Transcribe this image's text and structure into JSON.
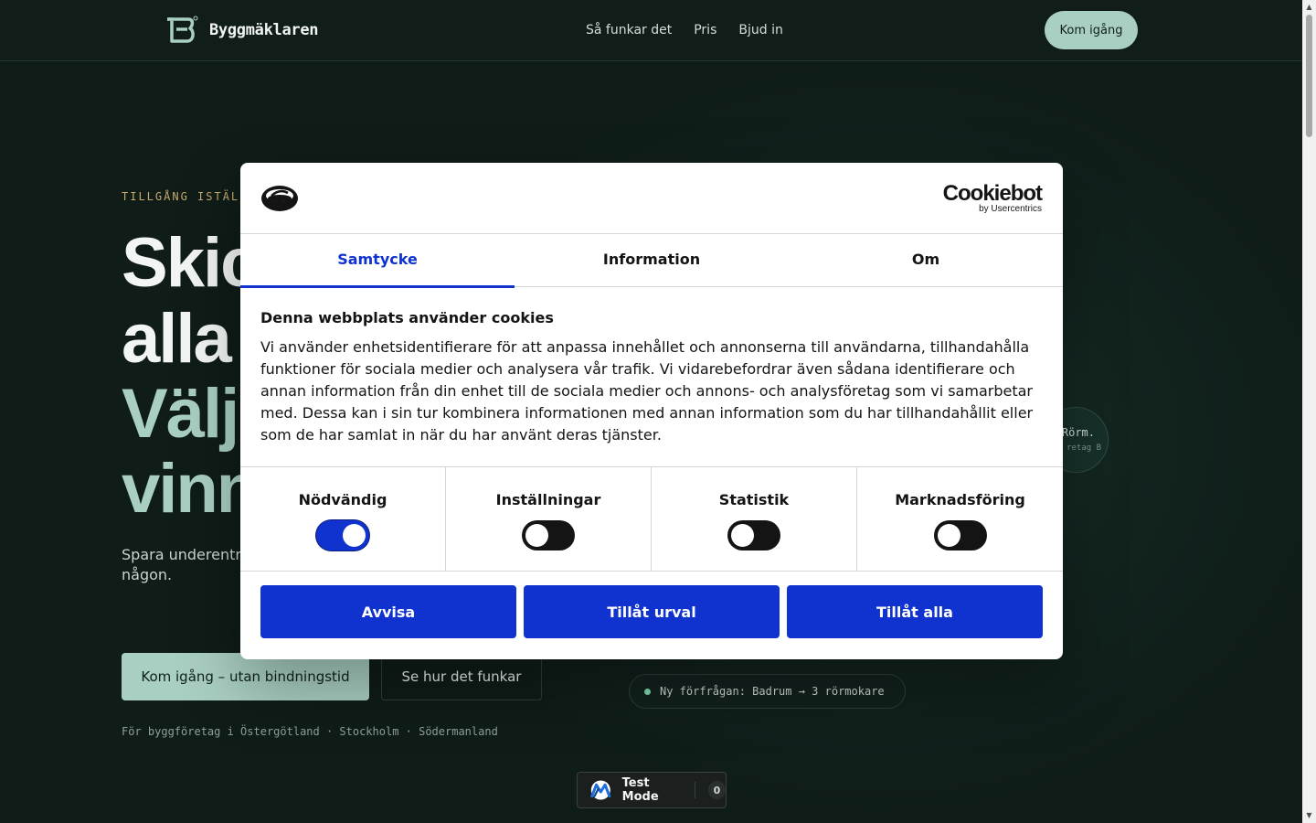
{
  "header": {
    "brand": "Byggmäklaren",
    "nav": [
      "Så funkar det",
      "Pris",
      "Bjud in"
    ],
    "cta": "Kom igång"
  },
  "hero": {
    "eyebrow": "TILLGÅNG ISTÄL",
    "lines": [
      "Skic",
      "alla",
      "Välj",
      "vinn"
    ],
    "subtitle": "Spara underentr förfrågan till hela yrkesgrupp, så f aldrig någon.",
    "primary_cta": "Kom igång – utan bindningstid",
    "secondary_cta": "Se hur det funkar",
    "regions": "För byggföretag i Östergötland · Stockholm · Södermanland"
  },
  "network": {
    "node_title": "Rörm.",
    "node_sub": "retag B",
    "notification": "Ny förfrågan: Badrum → 3 rörmokare"
  },
  "testmode": {
    "label": "Test Mode",
    "count": "0"
  },
  "cookie_dialog": {
    "brand": "Cookiebot",
    "brand_sub": "by Usercentrics",
    "tabs": [
      "Samtycke",
      "Information",
      "Om"
    ],
    "active_tab": "Samtycke",
    "title": "Denna webbplats använder cookies",
    "body": "Vi använder enhetsidentifierare för att anpassa innehållet och annonserna till användarna, tillhandahålla funktioner för sociala medier och analysera vår trafik. Vi vidarebefordrar även sådana identifierare och annan information från din enhet till de sociala medier och annons- och analysföretag som vi samarbetar med. Dessa kan i sin tur kombinera informationen med annan information som du har tillhandahållit eller som de har samlat in när du har använt deras tjänster.",
    "categories": [
      {
        "label": "Nödvändig",
        "enabled": true
      },
      {
        "label": "Inställningar",
        "enabled": false
      },
      {
        "label": "Statistik",
        "enabled": false
      },
      {
        "label": "Marknadsföring",
        "enabled": false
      }
    ],
    "buttons": {
      "deny": "Avvisa",
      "allow_selection": "Tillåt urval",
      "allow_all": "Tillåt alla"
    }
  },
  "colors": {
    "background": "#0f1d19",
    "accent_mint": "#a9cfc2",
    "eyebrow_gold": "#c7a96b",
    "cookie_blue": "#1032cf"
  }
}
